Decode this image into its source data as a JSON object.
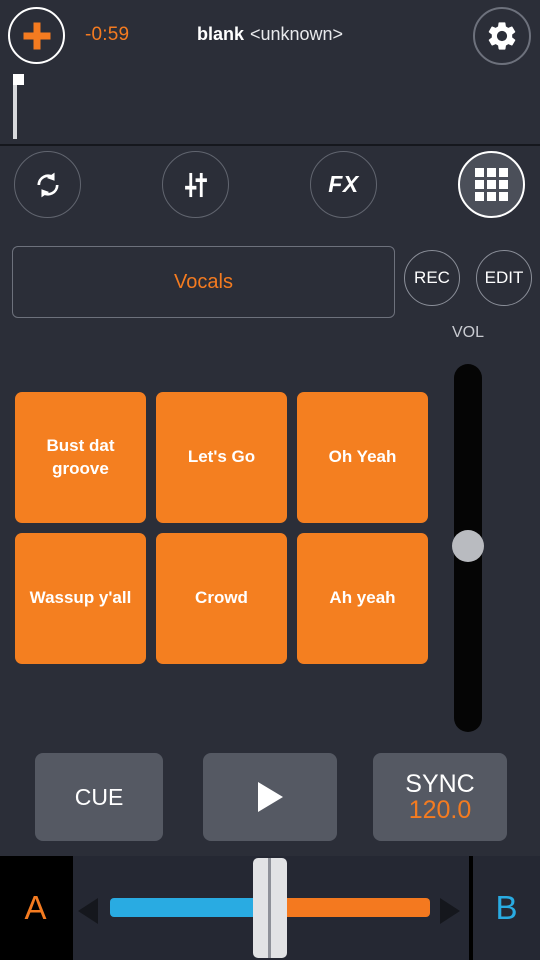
{
  "app": {
    "background_color": "#2b2e38",
    "accent_orange": "#f47b20",
    "accent_blue": "#29abe2"
  },
  "topbar": {
    "add_button": {
      "icon": "plus-icon",
      "label": "+"
    },
    "time_remaining": "-0:59",
    "track": {
      "name": "blank",
      "artist": "<unknown>"
    },
    "settings_button": {
      "icon": "gear-icon"
    },
    "beats_button": {
      "icon": "beat-bars-icon"
    }
  },
  "waveform": {
    "playhead_label": "playhead"
  },
  "modebar": {
    "buttons": [
      {
        "id": "loop",
        "icon": "loop-arrows-icon",
        "label": "",
        "active": false
      },
      {
        "id": "eq",
        "icon": "sliders-icon",
        "label": "",
        "active": false
      },
      {
        "id": "fx",
        "icon": "fx-text-icon",
        "label": "FX",
        "active": false
      },
      {
        "id": "pads",
        "icon": "grid-icon",
        "label": "",
        "active": true
      }
    ]
  },
  "bankrow": {
    "bank_name": "Vocals",
    "rec_label": "REC",
    "edit_label": "EDIT"
  },
  "volume": {
    "label": "VOL",
    "value_percent": 50
  },
  "pads": [
    {
      "label": "Bust dat groove"
    },
    {
      "label": "Let's Go"
    },
    {
      "label": "Oh Yeah"
    },
    {
      "label": "Wassup y'all"
    },
    {
      "label": "Crowd"
    },
    {
      "label": "Ah yeah"
    }
  ],
  "transport": {
    "cue_label": "CUE",
    "play_label": "play-icon",
    "sync_label": "SYNC",
    "bpm": "120.0"
  },
  "crossfader": {
    "deck_a_label": "A",
    "deck_b_label": "B",
    "position_percent": 50
  }
}
